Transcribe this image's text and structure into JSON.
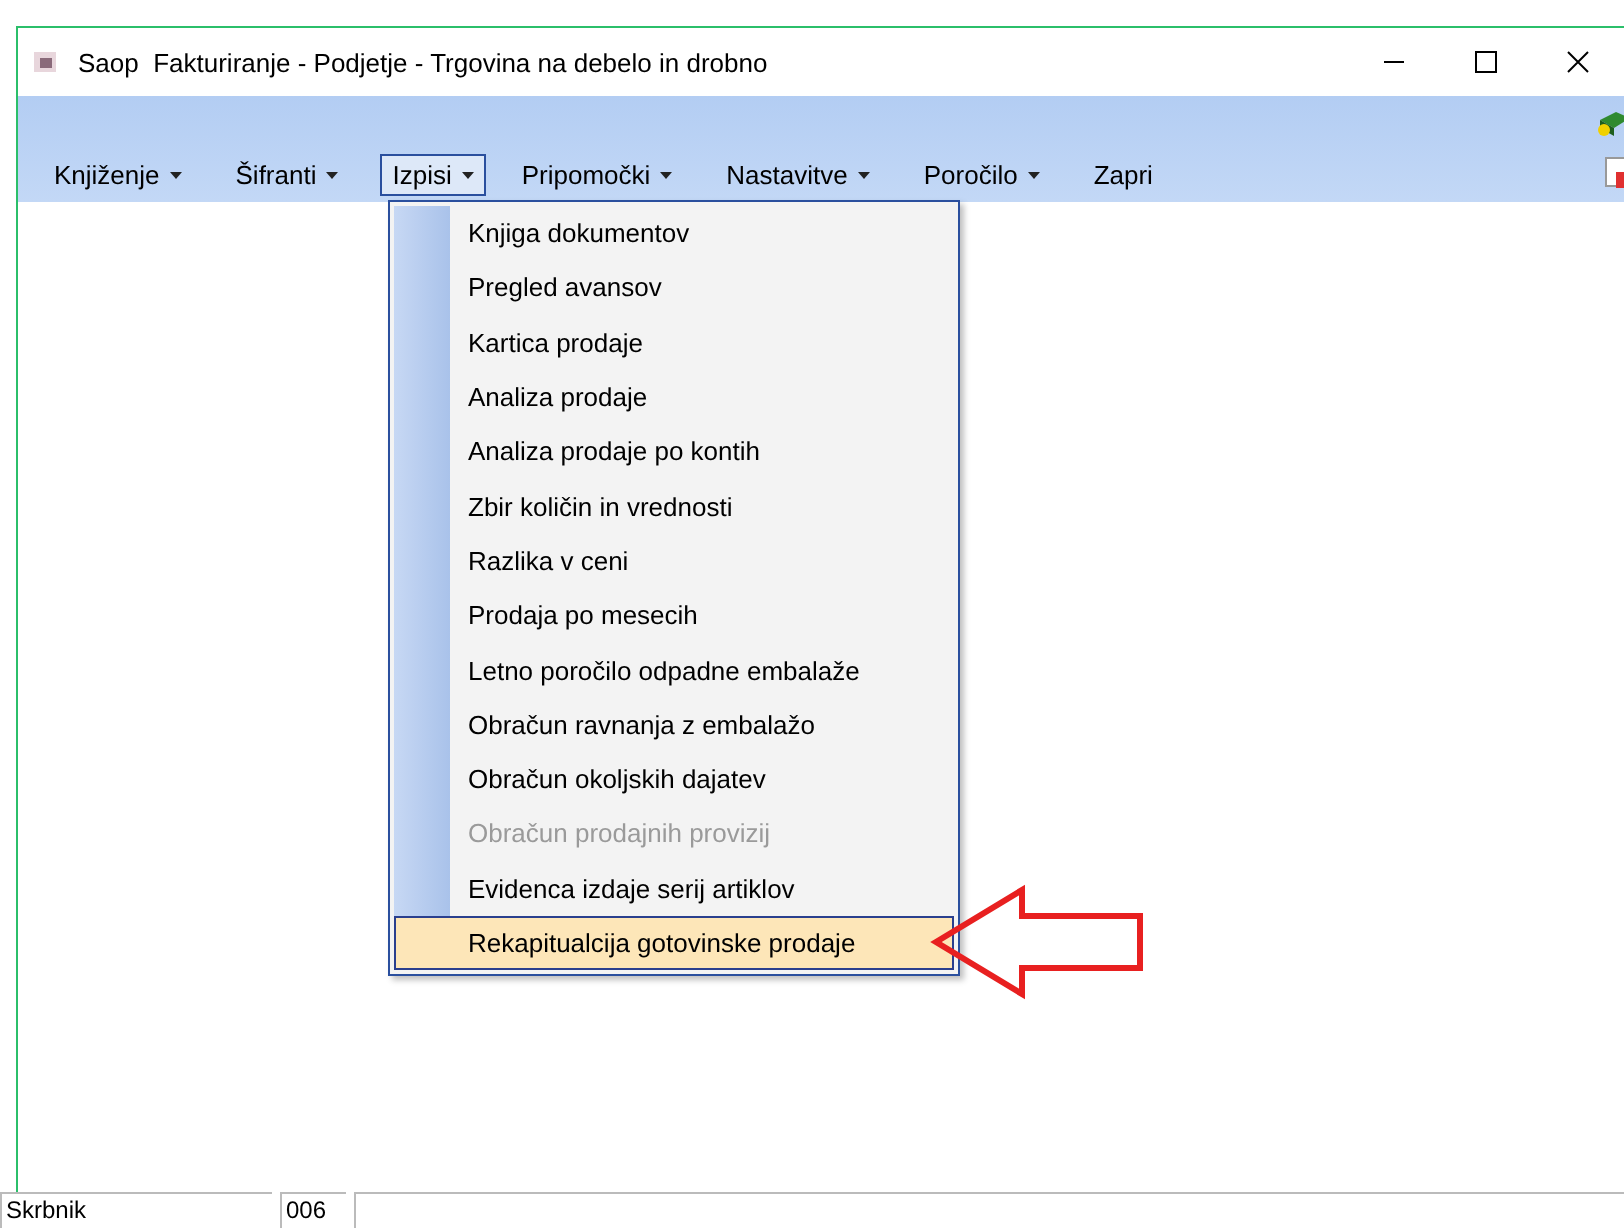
{
  "window": {
    "title": "Saop  Fakturiranje - Podjetje - Trgovina na debelo in drobno"
  },
  "menu_bar": [
    {
      "label": "Knjiženje",
      "dropdown": true,
      "selected": false
    },
    {
      "label": "Šifranti",
      "dropdown": true,
      "selected": false
    },
    {
      "label": "Izpisi",
      "dropdown": true,
      "selected": true
    },
    {
      "label": "Pripomočki",
      "dropdown": true,
      "selected": false
    },
    {
      "label": "Nastavitve",
      "dropdown": true,
      "selected": false
    },
    {
      "label": "Poročilo",
      "dropdown": true,
      "selected": false
    },
    {
      "label": "Zapri",
      "dropdown": false,
      "selected": false
    }
  ],
  "dropdown_menu": [
    {
      "label": "Knjiga dokumentov",
      "disabled": false,
      "selected": false
    },
    {
      "label": "Pregled avansov",
      "disabled": false,
      "selected": false
    },
    {
      "label": "Kartica prodaje",
      "disabled": false,
      "selected": false
    },
    {
      "label": "Analiza prodaje",
      "disabled": false,
      "selected": false
    },
    {
      "label": "Analiza prodaje po kontih",
      "disabled": false,
      "selected": false
    },
    {
      "label": "Zbir količin in vrednosti",
      "disabled": false,
      "selected": false
    },
    {
      "label": "Razlika v ceni",
      "disabled": false,
      "selected": false
    },
    {
      "label": "Prodaja po mesecih",
      "disabled": false,
      "selected": false
    },
    {
      "label": "Letno poročilo odpadne embalaže",
      "disabled": false,
      "selected": false
    },
    {
      "label": "Obračun ravnanja z embalažo",
      "disabled": false,
      "selected": false
    },
    {
      "label": "Obračun okoljskih dajatev",
      "disabled": false,
      "selected": false
    },
    {
      "label": "Obračun prodajnih provizij",
      "disabled": true,
      "selected": false
    },
    {
      "label": "Evidenca izdaje serij artiklov",
      "disabled": false,
      "selected": false
    },
    {
      "label": "Rekapitualcija gotovinske prodaje",
      "disabled": false,
      "selected": true
    }
  ],
  "status_bar": {
    "user": "Skrbnik",
    "code": "006"
  }
}
